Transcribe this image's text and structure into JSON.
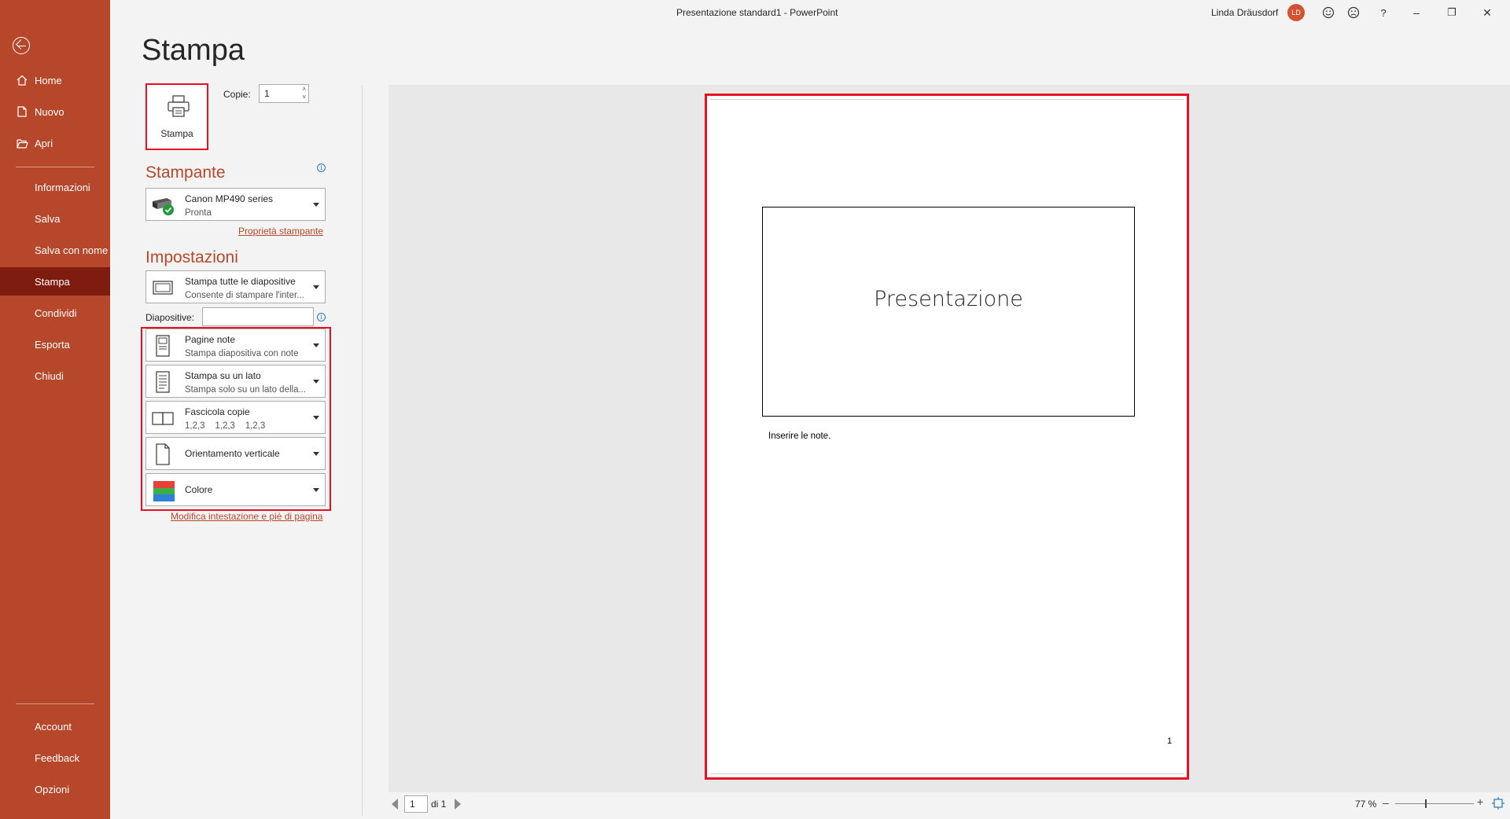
{
  "titlebar": {
    "doc_title": "Presentazione standard1  -  PowerPoint",
    "user_name": "Linda Dräusdorf",
    "avatar_initials": "LD",
    "help": "?",
    "minimize": "–",
    "restore": "❐",
    "close": "✕"
  },
  "nav": {
    "top_items": [
      {
        "label": "Home",
        "icon": "home-icon"
      },
      {
        "label": "Nuovo",
        "icon": "new-document-icon"
      },
      {
        "label": "Apri",
        "icon": "open-folder-icon"
      }
    ],
    "mid_items": [
      "Informazioni",
      "Salva",
      "Salva con nome",
      "Stampa",
      "Condividi",
      "Esporta",
      "Chiudi"
    ],
    "active": "Stampa",
    "bottom_items": [
      "Account",
      "Feedback",
      "Opzioni"
    ]
  },
  "print": {
    "title": "Stampa",
    "print_button_label": "Stampa",
    "copies_label": "Copie:",
    "copies_value": "1"
  },
  "printer": {
    "heading": "Stampante",
    "name": "Canon MP490 series",
    "status": "Pronta",
    "properties_link": "Proprietà stampante"
  },
  "settings": {
    "heading": "Impostazioni",
    "range": {
      "title": "Stampa tutte le diapositive",
      "subtitle": "Consente di stampare l'inter..."
    },
    "slides_label": "Diapositive:",
    "slides_value": "",
    "layout": {
      "title": "Pagine note",
      "subtitle": "Stampa diapositiva con note"
    },
    "sides": {
      "title": "Stampa su un lato",
      "subtitle": "Stampa solo su un lato della..."
    },
    "collate": {
      "title": "Fascicola copie",
      "subtitle": "1,2,3    1,2,3    1,2,3"
    },
    "orientation": {
      "title": "Orientamento verticale"
    },
    "color": {
      "title": "Colore"
    },
    "header_footer_link": "Modifica intestazione e piè di pagina"
  },
  "preview": {
    "slide_title": "Presentazione",
    "notes": "Inserire le note.",
    "page_number": "1"
  },
  "bottombar": {
    "page_value": "1",
    "page_of": "di 1",
    "zoom": "77 %",
    "zoom_minus": "–",
    "zoom_plus": "+"
  },
  "colors": {
    "accent": "#b7472a",
    "nav_active": "#7e1c0f",
    "highlight": "#e81123"
  }
}
